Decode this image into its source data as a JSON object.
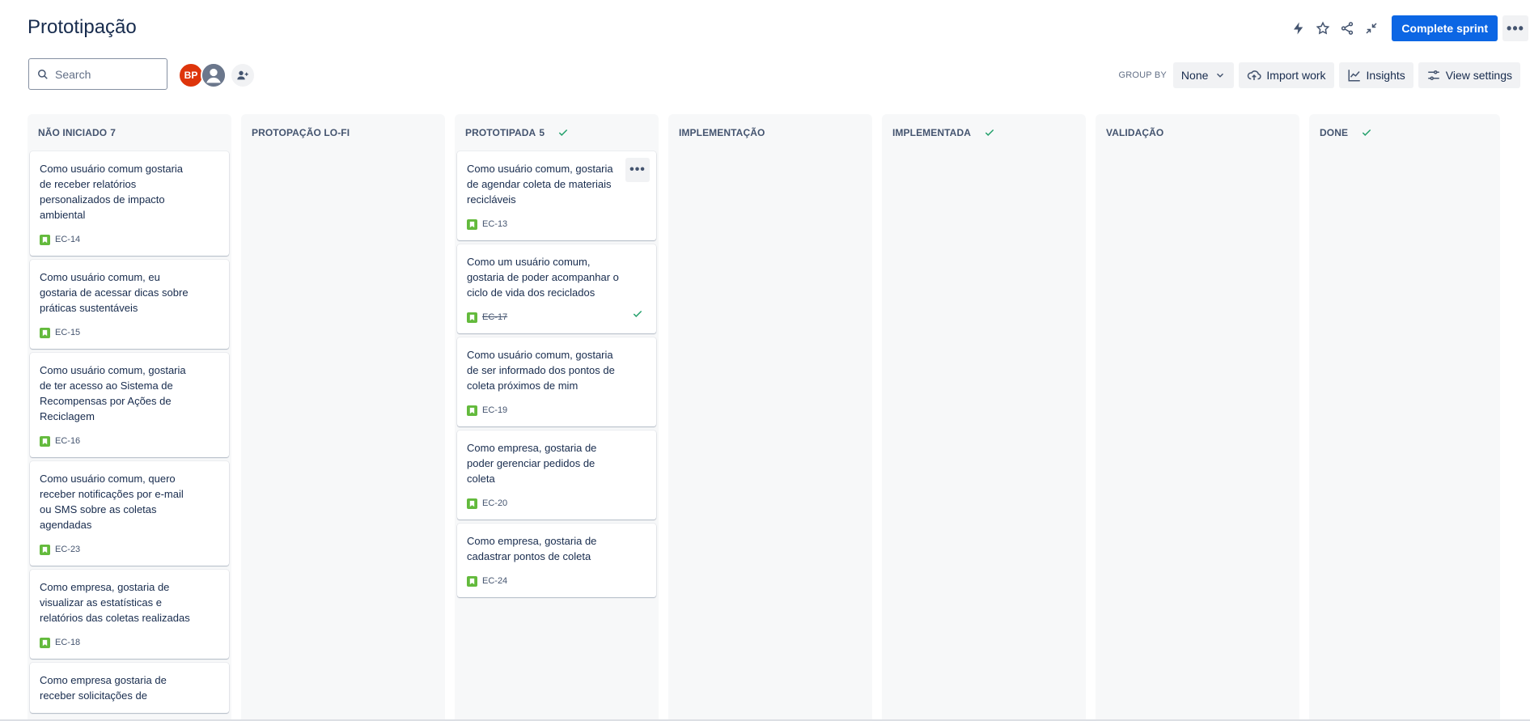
{
  "page": {
    "title": "Prototipação"
  },
  "toolbar": {
    "complete_sprint_label": "Complete sprint"
  },
  "search": {
    "placeholder": "Search",
    "value": ""
  },
  "avatars": {
    "initials": "BP"
  },
  "controls": {
    "group_by_label": "GROUP BY",
    "group_by_value": "None",
    "import_label": "Import work",
    "insights_label": "Insights",
    "view_settings_label": "View settings"
  },
  "columns": [
    {
      "name": "NÃO INICIADO",
      "count": "7",
      "done": false,
      "cards": [
        {
          "text": "Como usuário comum gostaria de receber relatórios personalizados de impacto ambiental",
          "key": "EC-14"
        },
        {
          "text": "Como usuário comum, eu gostaria de acessar dicas sobre práticas sustentáveis",
          "key": "EC-15"
        },
        {
          "text": "Como usuário comum, gostaria de ter acesso ao Sistema de Recompensas por Ações de Reciclagem",
          "key": "EC-16"
        },
        {
          "text": "Como usuário comum, quero receber notificações por e-mail ou SMS sobre as coletas agendadas",
          "key": "EC-23"
        },
        {
          "text": "Como empresa, gostaria de visualizar as estatísticas e relatórios das coletas realizadas",
          "key": "EC-18"
        },
        {
          "text": "Como empresa gostaria de receber solicitações de",
          "key": ""
        }
      ]
    },
    {
      "name": "PROTOPAÇÃO LO-FI",
      "count": "",
      "done": false,
      "cards": []
    },
    {
      "name": "PROTOTIPADA",
      "count": "5",
      "done": true,
      "cards": [
        {
          "text": "Como usuário comum, gostaria de agendar coleta de materiais recicláveis",
          "key": "EC-13",
          "more": true
        },
        {
          "text": "Como um usuário comum, gostaria de poder acompanhar o ciclo de vida dos reciclados",
          "key": "EC-17",
          "resolved": true
        },
        {
          "text": "Como usuário comum, gostaria de ser informado dos pontos de coleta próximos de mim",
          "key": "EC-19"
        },
        {
          "text": "Como empresa, gostaria de poder gerenciar pedidos de coleta",
          "key": "EC-20"
        },
        {
          "text": "Como empresa, gostaria de cadastrar pontos de coleta",
          "key": "EC-24"
        }
      ]
    },
    {
      "name": "IMPLEMENTAÇÃO",
      "count": "",
      "done": false,
      "cards": []
    },
    {
      "name": "IMPLEMENTADA",
      "count": "",
      "done": true,
      "cards": []
    },
    {
      "name": "VALIDAÇÃO",
      "count": "",
      "done": false,
      "cards": []
    },
    {
      "name": "DONE",
      "count": "",
      "done": true,
      "cards": []
    }
  ],
  "colors": {
    "primary": "#0c66e4",
    "story": "#63ba3c",
    "success": "#22a06b",
    "avatar_bp": "#de350b"
  }
}
